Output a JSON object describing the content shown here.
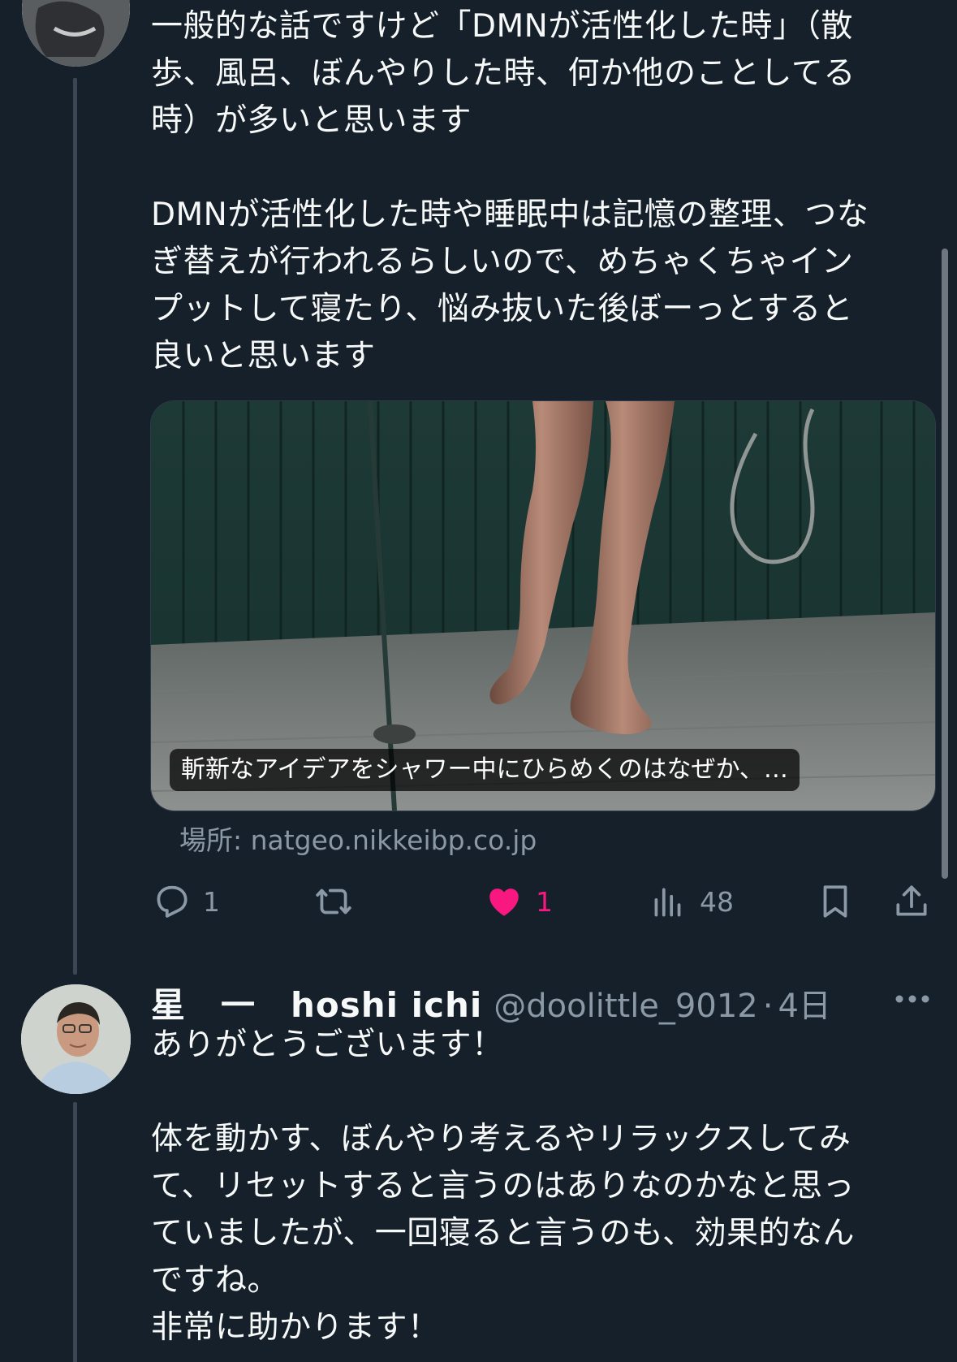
{
  "tweet1": {
    "text": "一般的な話ですけど「DMNが活性化した時」（散\n歩、風呂、ぼんやりした時、何か他のことしてる\n時）が多いと思います\n\nDMNが活性化した時や睡眠中は記憶の整理、つな\nぎ替えが行われるらしいので、めちゃくちゃイン\nプットして寝たり、悩み抜いた後ぼーっとすると\n良いと思います",
    "card": {
      "caption": "斬新なアイデアをシャワー中にひらめくのはなぜか、…",
      "source": "場所: natgeo.nikkeibp.co.jp"
    },
    "actions": {
      "reply_icon": "reply-icon",
      "reply_count": "1",
      "retweet_icon": "retweet-icon",
      "retweet_count": "",
      "like_icon": "heart-filled-icon",
      "like_count": "1",
      "views_icon": "views-icon",
      "views_count": "48",
      "bookmark_icon": "bookmark-icon",
      "share_icon": "share-icon"
    }
  },
  "tweet2": {
    "display_name": "星　一　hoshi ichi",
    "handle": "@doolittle_9012",
    "separator": "·",
    "time": "4日",
    "more_icon": "more-icon",
    "text": "ありがとうございます！\n\n体を動かす、ぼんやり考えるやリラックスしてみ\nて、リセットすると言うのはありなのかなと思っ\nていましたが、一回寝ると言うのも、効果的なん\nですね。\n非常に助かります！"
  },
  "colors": {
    "background": "#15202b",
    "text_primary": "#f7f9f9",
    "text_secondary": "#8b98a5",
    "like_active": "#f91880",
    "thread_line": "#3a4651"
  }
}
